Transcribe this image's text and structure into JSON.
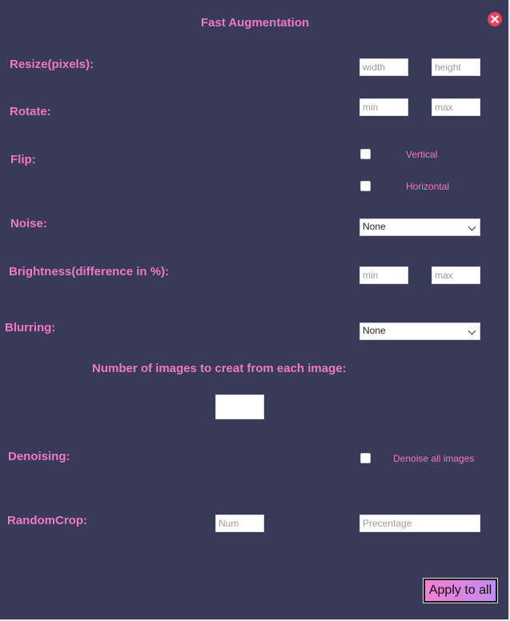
{
  "dialog": {
    "title": "Fast Augmentation",
    "close_icon": "close-icon"
  },
  "resize": {
    "label": "Resize(pixels):",
    "width_placeholder": "width",
    "height_placeholder": "height"
  },
  "rotate": {
    "label": "Rotate:",
    "min_placeholder": "min",
    "max_placeholder": "max"
  },
  "flip": {
    "label": "Flip:",
    "vertical_label": "Vertical",
    "horizontal_label": "Horizontal"
  },
  "noise": {
    "label": "Noise:",
    "selected": "None"
  },
  "brightness": {
    "label": "Brightness(difference in %):",
    "min_placeholder": "min",
    "max_placeholder": "max"
  },
  "blurring": {
    "label": "Blurring:",
    "selected": "None"
  },
  "num_images": {
    "label": "Number of images to creat from each image:",
    "value": ""
  },
  "denoising": {
    "label": "Denoising:",
    "option_label": "Denoise all images"
  },
  "random_crop": {
    "label": "RandomCrop:",
    "num_placeholder": "Num",
    "percentage_placeholder": "Precentage"
  },
  "apply_button": {
    "label": "Apply to all"
  },
  "colors": {
    "background": "#393a57",
    "accent": "#ee79c9",
    "close": "#e0485a"
  }
}
